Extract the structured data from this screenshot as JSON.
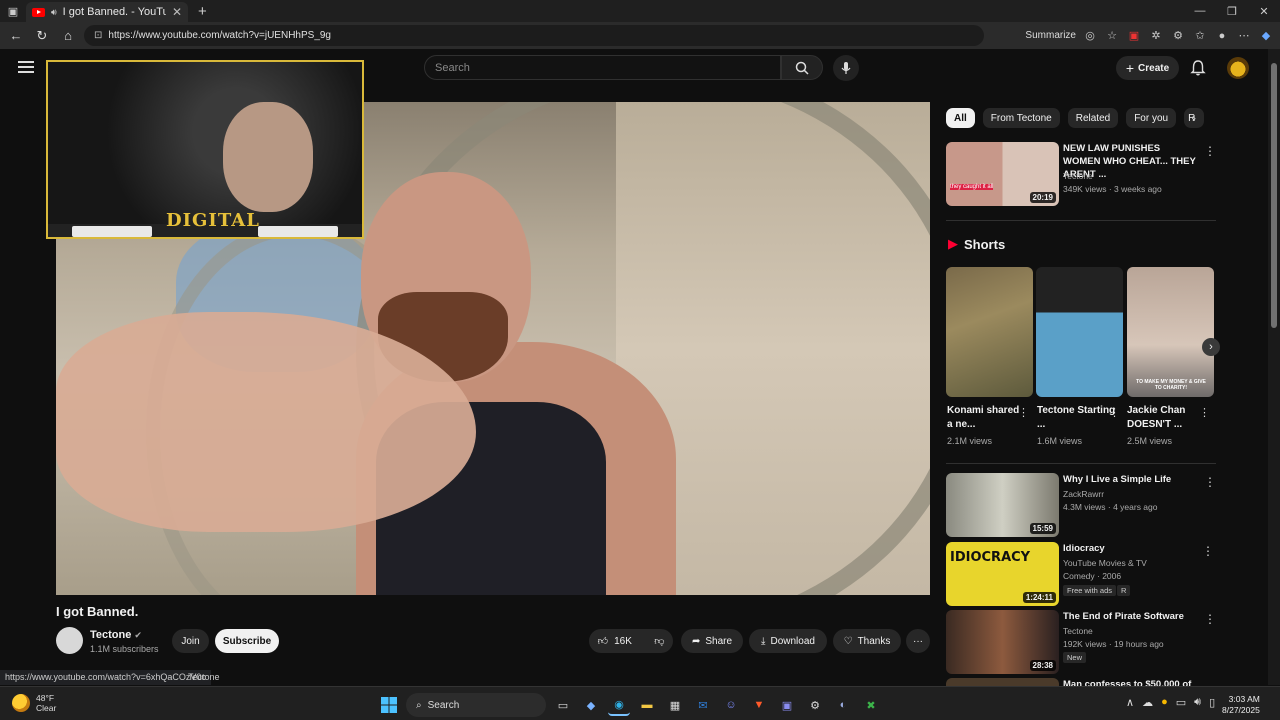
{
  "browser": {
    "tab_title": "I got Banned. - YouTube",
    "url": "https://www.youtube.com/watch?v=jUENHhPS_9g",
    "summarize_label": "Summarize"
  },
  "youtube": {
    "search_placeholder": "Search",
    "create_label": "Create"
  },
  "video": {
    "title": "I got Banned.",
    "webcam_logo_text": "DIGITAL",
    "channel": "Tectone",
    "subscribers": "1.1M subscribers",
    "join_label": "Join",
    "subscribe_label": "Subscribe",
    "likes": "16K",
    "share_label": "Share",
    "download_label": "Download",
    "thanks_label": "Thanks",
    "more_label": "···"
  },
  "status_bar": {
    "link_url": "https://www.youtube.com/watch?v=6xhQaCOzV0c",
    "link_channel": "Tectone"
  },
  "chips": [
    "All",
    "From Tectone",
    "Related",
    "For you",
    "R"
  ],
  "recommendations": [
    {
      "title": "NEW LAW PUNISHES WOMEN WHO CHEAT... THEY ARENT ...",
      "channel": "Tectone",
      "meta": "349K views · 3 weeks ago",
      "duration": "20:19",
      "thumb_text": "they caught it all"
    },
    {
      "title": "Why I Live a Simple Life",
      "channel": "ZackRawrr",
      "meta": "4.3M views · 4 years ago",
      "duration": "15:59"
    },
    {
      "title": "Idiocracy",
      "channel": "YouTube Movies & TV",
      "meta": "Comedy · 2006",
      "badge1": "Free with ads",
      "badge2": "R",
      "duration": "1:24:11",
      "thumb_text": "IDIOCRACY"
    },
    {
      "title": "The End of Pirate Software",
      "channel": "Tectone",
      "meta": "192K views · 19 hours ago",
      "badge1": "New",
      "duration": "28:38"
    },
    {
      "title": "Man confesses to $50,000 of"
    }
  ],
  "shorts": {
    "heading": "Shorts",
    "items": [
      {
        "title": "Konami shared a ne...",
        "views": "2.1M views"
      },
      {
        "title": "Tectone Starting ...",
        "views": "1.6M views"
      },
      {
        "title": "Jackie Chan DOESN'T ...",
        "views": "2.5M views",
        "thumb_text": "TO MAKE MY MONEY & GIVE TO CHARITY!"
      }
    ]
  },
  "taskbar": {
    "temp": "48°F",
    "condition": "Clear",
    "search_label": "Search",
    "time": "3:03 AM",
    "date": "8/27/2025"
  }
}
